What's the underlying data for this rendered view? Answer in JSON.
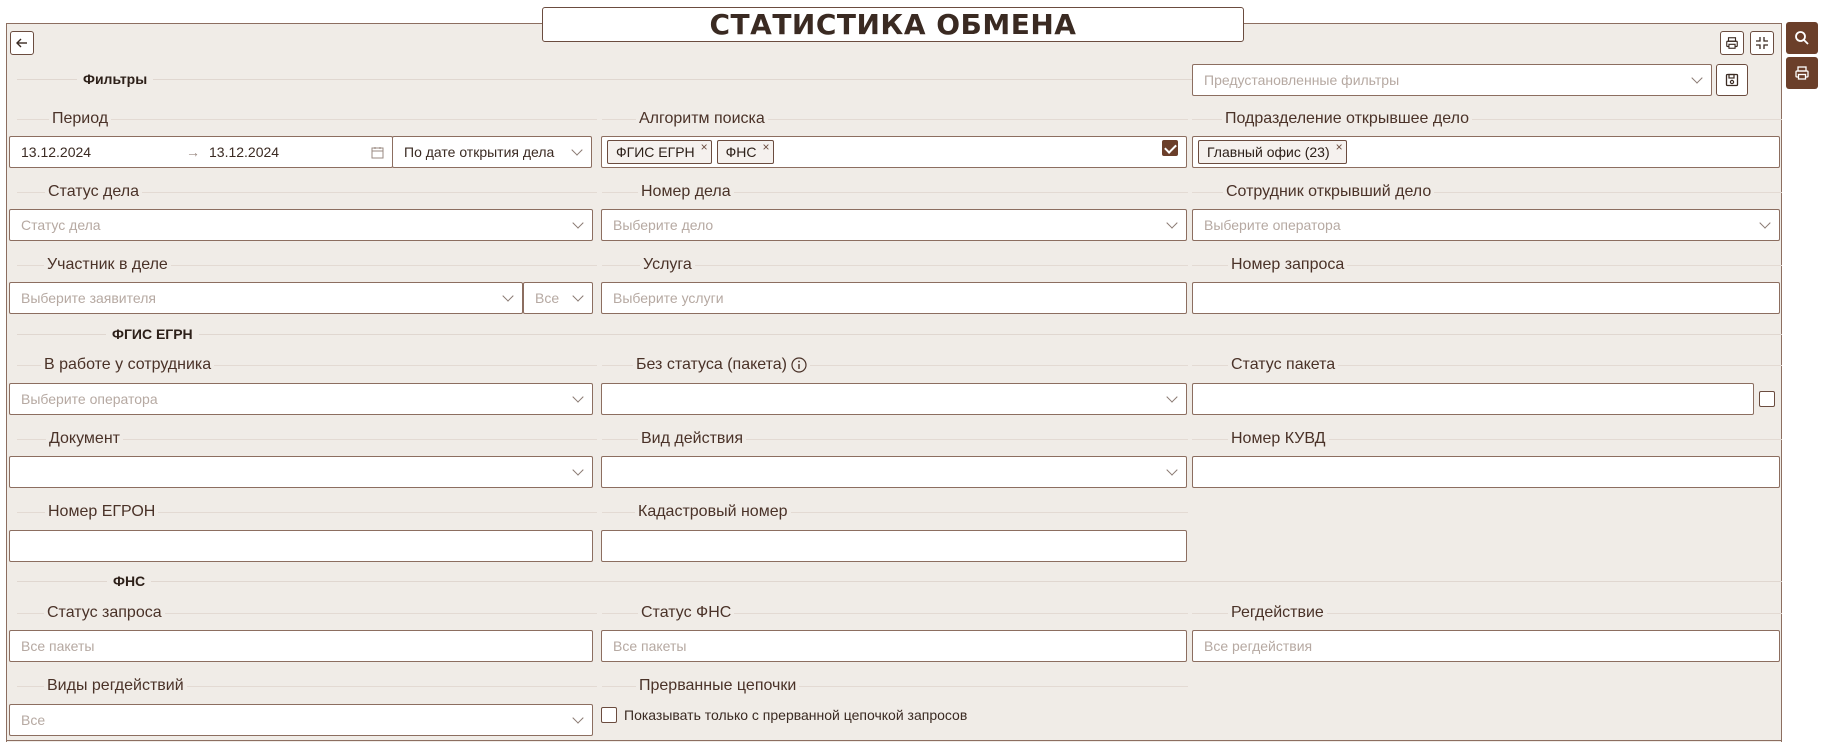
{
  "header": {
    "title": "СТАТИСТИКА ОБМЕНА"
  },
  "filters": {
    "section_label": "Фильтры",
    "preset_placeholder": "Предустановленные фильтры"
  },
  "period": {
    "label": "Период",
    "from": "13.12.2024",
    "to": "13.12.2024",
    "mode": "По дате открытия дела"
  },
  "algorithm": {
    "label": "Алгоритм поиска",
    "tags": [
      "ФГИС ЕГРН",
      "ФНС"
    ]
  },
  "department": {
    "label": "Подразделение открывшее дело",
    "tags": [
      "Главный офис (23)"
    ]
  },
  "case_status": {
    "label": "Статус дела",
    "placeholder": "Статус дела"
  },
  "case_number": {
    "label": "Номер дела",
    "placeholder": "Выберите дело"
  },
  "opener": {
    "label": "Сотрудник открывший дело",
    "placeholder": "Выберите оператора"
  },
  "participant": {
    "label": "Участник в деле",
    "placeholder": "Выберите заявителя",
    "scope": "Все"
  },
  "service": {
    "label": "Услуга",
    "placeholder": "Выберите услуги"
  },
  "request_number": {
    "label": "Номер запроса"
  },
  "egrn": {
    "section_label": "ФГИС ЕГРН",
    "in_work": {
      "label": "В работе у сотрудника",
      "placeholder": "Выберите оператора"
    },
    "no_status": {
      "label": "Без статуса (пакета)"
    },
    "package_status": {
      "label": "Статус пакета"
    },
    "document": {
      "label": "Документ"
    },
    "action_type": {
      "label": "Вид действия"
    },
    "kuvd": {
      "label": "Номер КУВД"
    },
    "egron": {
      "label": "Номер ЕГРОН"
    },
    "cadastral": {
      "label": "Кадастровый номер"
    }
  },
  "fns": {
    "section_label": "ФНС",
    "request_status": {
      "label": "Статус запроса",
      "placeholder": "Все пакеты"
    },
    "fns_status": {
      "label": "Статус ФНС",
      "placeholder": "Все пакеты"
    },
    "reg_action": {
      "label": "Регдействие",
      "placeholder": "Все регдействия"
    },
    "reg_action_types": {
      "label": "Виды регдействий",
      "placeholder": "Все"
    },
    "broken_chains": {
      "label": "Прерванные цепочки",
      "checkbox_label": "Показывать только с прерванной цепочкой запросов"
    }
  },
  "colors": {
    "accent": "#6b3f2a",
    "panel_bg": "#f0ece7",
    "border": "#8c6e60"
  },
  "icons": [
    "back-arrow-icon",
    "print-icon",
    "fullscreen-exit-icon",
    "search-icon",
    "save-icon",
    "calendar-icon",
    "info-icon"
  ]
}
